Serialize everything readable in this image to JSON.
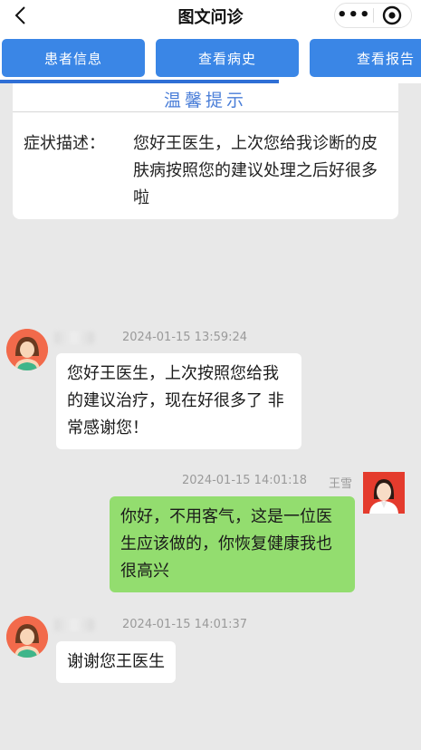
{
  "header": {
    "title": "图文问诊"
  },
  "tabs": [
    {
      "label": "患者信息"
    },
    {
      "label": "查看病史"
    },
    {
      "label": "查看报告"
    }
  ],
  "notice": {
    "title": "温馨提示",
    "label": "症状描述：",
    "text": "您好王医生，上次您给我诊断的皮肤病按照您的建议处理之后好很多啦"
  },
  "messages": [
    {
      "time": "2024-01-15 13:59:24",
      "text": "您好王医生，上次按照您给我的建议治疗，现在好很多了 非常感谢您！"
    },
    {
      "time": "2024-01-15 14:01:18",
      "sender": "王雪",
      "text": "你好，不用客气，这是一位医生应该做的，你恢复健康我也很高兴"
    },
    {
      "time": "2024-01-15 14:01:37",
      "text": "谢谢您王医生"
    }
  ],
  "colors": {
    "tab": "#3a86e6",
    "patient_bubble": "#ffffff",
    "doctor_bubble": "#93dd6f",
    "notice_title": "#4a7ed8"
  },
  "icons": [
    "back-arrow-icon",
    "more-dots-icon",
    "close-target-icon",
    "patient-avatar-icon",
    "doctor-avatar-icon"
  ]
}
